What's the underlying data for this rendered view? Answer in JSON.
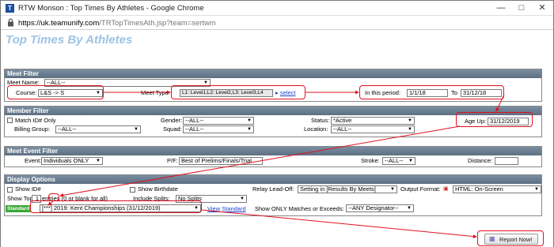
{
  "window": {
    "title": "RTW Monson : Top Times By Athletes - Google Chrome",
    "favicon": "T"
  },
  "address": {
    "host": "https://uk.teamunify.com",
    "path": "/TRTopTimesAth.jsp?team=sertwm"
  },
  "page_title": "Top Times By Athletes",
  "meet_filter": {
    "heading": "Meet Filter",
    "meet_name_label": "Meet Name:",
    "meet_name_value": "--ALL--",
    "course_label": "Course:",
    "course_value": "L&S -> S",
    "meet_type_label": "Meet Type:",
    "meet_type_value": "L1: Level1,L2: Level2,L3: Level3,L4",
    "select_link": "select",
    "period_label": "In this period:",
    "period_from": "1/1/18",
    "to_label": "To",
    "period_to": "31/12/18"
  },
  "member_filter": {
    "heading": "Member Filter",
    "match_id_label": "Match ID# Only",
    "billing_label": "Billing Group:",
    "billing_value": "--ALL--",
    "gender_label": "Gender:",
    "gender_value": "--ALL--",
    "squad_label": "Squad:",
    "squad_value": "--ALL--",
    "status_label": "Status:",
    "status_value": "*Active",
    "location_label": "Location:",
    "location_value": "--ALL--",
    "age_up_label": "Age Up:",
    "age_up_value": "31/12/2019"
  },
  "event_filter": {
    "heading": "Meet Event Filter",
    "event_label": "Event:",
    "event_value": "Individuals ONLY",
    "pf_label": "P/F:",
    "pf_value": "Best of Prelims/Finals/Trial",
    "stroke_label": "Stroke:",
    "stroke_value": "--ALL--",
    "distance_label": "Distance:",
    "distance_value": ""
  },
  "display_options": {
    "heading": "Display Options",
    "show_id_label": "Show ID#",
    "show_birthdate_label": "Show Birthdate",
    "relay_label": "Relay Lead-Off:",
    "relay_value": "Setting in [Results By Meets]",
    "output_label": "Output Format:",
    "output_value": "HTML: On-Screen",
    "show_top_label": "Show Top",
    "show_top_value": "1",
    "entries_label": "entries (0 or blank for all)",
    "splits_label": "Include Splits:",
    "splits_value": "No Splits",
    "standard_badge": "Standard",
    "standard_value": "[***] 2019: Kent Championships (31/12/2019)",
    "view_standard": "View Standard",
    "matches_label": "Show ONLY Matches or Exceeds:",
    "matches_value": "--ANY Designator--"
  },
  "report_button": "Report Now!",
  "colors": {
    "annotation": "#e01020",
    "section_header": "#6a7c8f",
    "title": "#9dc3e6",
    "standard_badge": "#3aa636"
  }
}
